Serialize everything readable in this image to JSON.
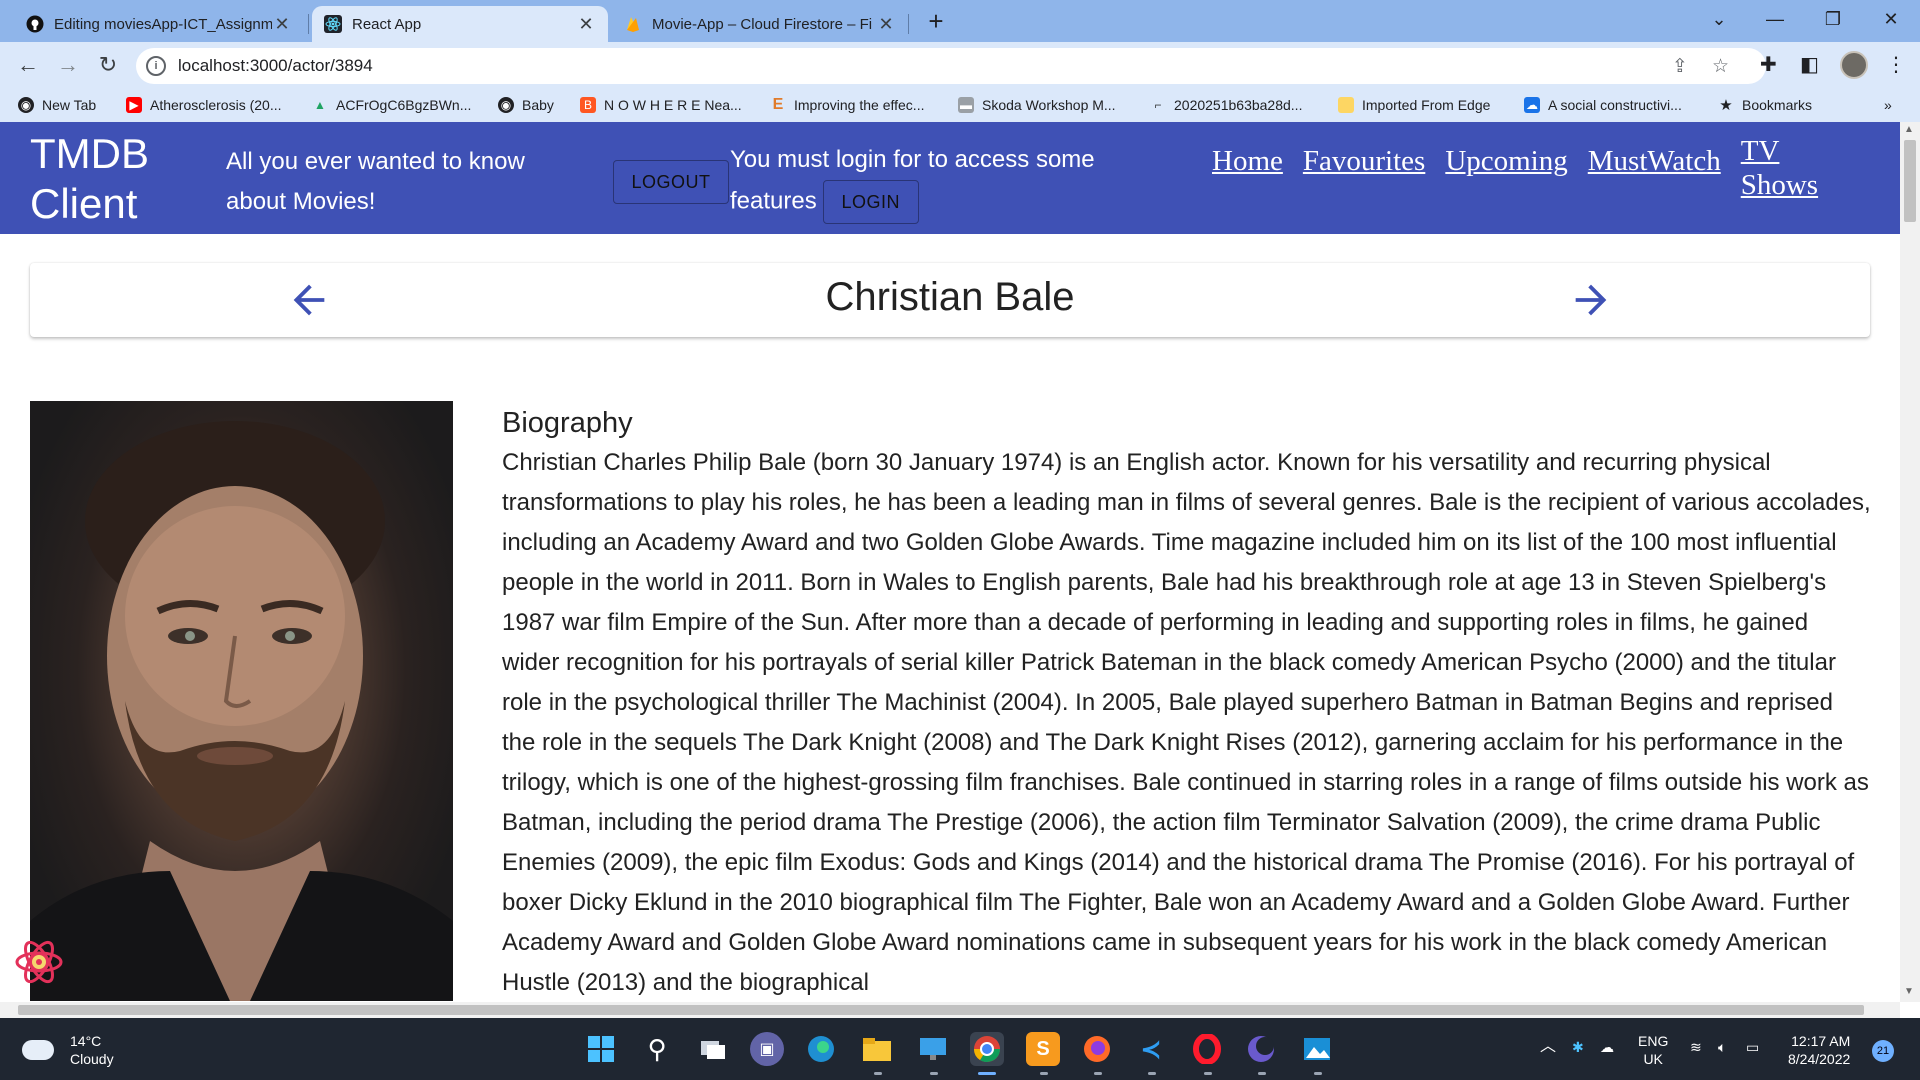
{
  "browser": {
    "tabs": [
      {
        "title": "Editing moviesApp-ICT_Assignm",
        "icon": "github-icon"
      },
      {
        "title": "React App",
        "icon": "react-icon"
      },
      {
        "title": "Movie-App – Cloud Firestore – Fi",
        "icon": "firebase-icon"
      }
    ],
    "url": "localhost:3000/actor/3894",
    "bookmarks": [
      "New Tab",
      "Atherosclerosis (20...",
      "ACFrOgC6BgzBWn...",
      "Baby",
      "N O W H E R E Nea...",
      "Improving the effec...",
      "Skoda Workshop M...",
      "2020251b63ba28d...",
      "Imported From Edge",
      "A social constructivi...",
      "Bookmarks"
    ]
  },
  "app": {
    "brand": "TMDB Client",
    "tagline": "All you ever wanted to know about Movies!",
    "logout_label": "LOGOUT",
    "login_message": "You must login for to access some features",
    "login_label": "LOGIN",
    "nav": [
      "Home",
      "Favourites",
      "Upcoming",
      "MustWatch",
      "TV Shows"
    ]
  },
  "actor": {
    "name": "Christian Bale",
    "bio_heading": "Biography",
    "biography": "Christian Charles Philip Bale (born 30 January 1974) is an English actor. Known for his versatility and recurring physical transformations to play his roles, he has been a leading man in films of several genres. Bale is the recipient of various accolades, including an Academy Award and two Golden Globe Awards. Time magazine included him on its list of the 100 most influential people in the world in 2011. Born in Wales to English parents, Bale had his breakthrough role at age 13 in Steven Spielberg's 1987 war film Empire of the Sun. After more than a decade of performing in leading and supporting roles in films, he gained wider recognition for his portrayals of serial killer Patrick Bateman in the black comedy American Psycho (2000) and the titular role in the psychological thriller The Machinist (2004). In 2005, Bale played superhero Batman in Batman Begins and reprised the role in the sequels The Dark Knight (2008) and The Dark Knight Rises (2012), garnering acclaim for his performance in the trilogy, which is one of the highest-grossing film franchises. Bale continued in starring roles in a range of films outside his work as Batman, including the period drama The Prestige (2006), the action film Terminator Salvation (2009), the crime drama Public Enemies (2009), the epic film Exodus: Gods and Kings (2014) and the historical drama The Promise (2016). For his portrayal of boxer Dicky Eklund in the 2010 biographical film The Fighter, Bale won an Academy Award and a Golden Globe Award. Further Academy Award and Golden Globe Award nominations came in subsequent years for his work in the black comedy American Hustle (2013) and the biographical"
  },
  "taskbar": {
    "temperature": "14°C",
    "condition": "Cloudy",
    "language": "ENG",
    "region": "UK",
    "time": "12:17 AM",
    "date": "8/24/2022",
    "notifications": "21"
  },
  "colors": {
    "appbar": "#3f51b5",
    "tabstrip": "#8fb5ea",
    "toolbar": "#dbe8fa"
  }
}
